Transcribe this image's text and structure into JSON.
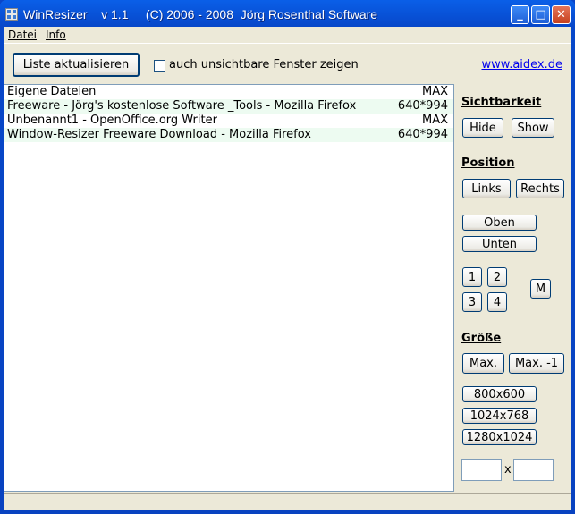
{
  "window": {
    "title": "WinResizer    v 1.1     (C) 2006 - 2008  Jörg Rosenthal Software",
    "controls": [
      "minimize",
      "maximize",
      "close"
    ]
  },
  "menu": [
    {
      "label": "Datei"
    },
    {
      "label": "Info"
    }
  ],
  "toolbar": {
    "refresh_label": "Liste aktualisieren",
    "checkbox_label": "auch unsichtbare Fenster zeigen",
    "checkbox_checked": false,
    "link": "www.aidex.de"
  },
  "windows": [
    {
      "title": "Eigene Dateien",
      "size": "MAX"
    },
    {
      "title": "Freeware - Jörg's kostenlose Software _Tools - Mozilla Firefox",
      "size": "640*994"
    },
    {
      "title": "Unbenannt1 - OpenOffice.org Writer",
      "size": "MAX"
    },
    {
      "title": "Window-Resizer Freeware Download - Mozilla Firefox",
      "size": "640*994"
    }
  ],
  "panel": {
    "visibility": {
      "heading": "Sichtbarkeit",
      "hide": "Hide",
      "show": "Show"
    },
    "position": {
      "heading": "Position",
      "left": "Links",
      "right": "Rechts",
      "top": "Oben",
      "bottom": "Unten",
      "q1": "1",
      "q2": "2",
      "q3": "3",
      "q4": "4",
      "middle": "M"
    },
    "size": {
      "heading": "Größe",
      "max": "Max.",
      "max_minus": "Max. -1",
      "s1": "800x600",
      "s2": "1024x768",
      "s3": "1280x1024",
      "x": "x",
      "width_value": "",
      "height_value": ""
    }
  }
}
